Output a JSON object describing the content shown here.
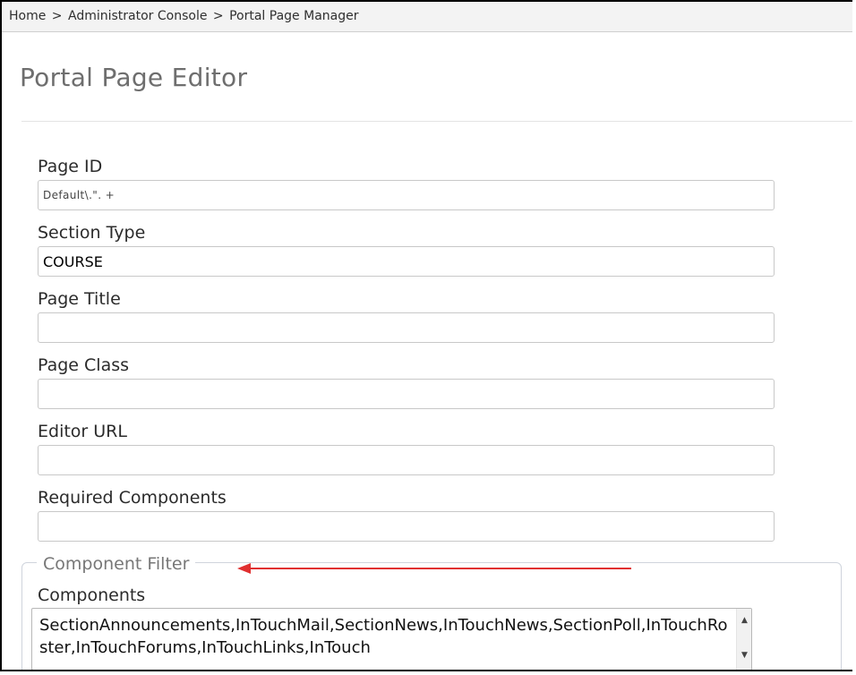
{
  "breadcrumb": {
    "items": [
      "Home",
      "Administrator Console",
      "Portal Page Manager"
    ],
    "separator": ">"
  },
  "page": {
    "title": "Portal Page Editor"
  },
  "fields": {
    "page_id": {
      "label": "Page ID",
      "value": "Default\\.\". +"
    },
    "section_type": {
      "label": "Section Type",
      "value": "COURSE"
    },
    "page_title": {
      "label": "Page Title",
      "value": ""
    },
    "page_class": {
      "label": "Page Class",
      "value": ""
    },
    "editor_url": {
      "label": "Editor URL",
      "value": ""
    },
    "required_components": {
      "label": "Required Components",
      "value": ""
    }
  },
  "component_filter": {
    "legend": "Component Filter",
    "components_label": "Components",
    "components_value": "SectionAnnouncements,InTouchMail,SectionNews,InTouchNews,SectionPoll,InTouchRoster,InTouchForums,InTouchLinks,InTouch"
  },
  "annotation": {
    "arrow_color": "#e03030",
    "icon": "left-arrow-icon"
  },
  "scrollbar": {
    "up_icon": "scroll-up-arrow-icon",
    "down_icon": "scroll-down-arrow-icon"
  },
  "colors": {
    "text": "#2b2b2b",
    "title": "#6e6e6e",
    "border": "#c8c8c8",
    "breadcrumb_bg": "#f3f3f3",
    "arrow": "#e03030"
  }
}
